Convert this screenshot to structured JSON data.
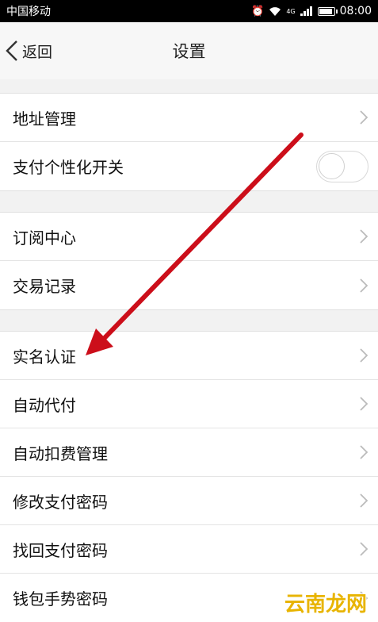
{
  "status_bar": {
    "carrier": "中国移动",
    "network": "4G",
    "time": "08:00"
  },
  "nav": {
    "back_label": "返回",
    "title": "设置"
  },
  "groups": [
    {
      "items": [
        {
          "label": "地址管理",
          "type": "link"
        },
        {
          "label": "支付个性化开关",
          "type": "toggle",
          "on": false
        }
      ]
    },
    {
      "items": [
        {
          "label": "订阅中心",
          "type": "link"
        },
        {
          "label": "交易记录",
          "type": "link"
        }
      ]
    },
    {
      "items": [
        {
          "label": "实名认证",
          "type": "link"
        },
        {
          "label": "自动代付",
          "type": "link"
        },
        {
          "label": "自动扣费管理",
          "type": "link"
        },
        {
          "label": "修改支付密码",
          "type": "link"
        },
        {
          "label": "找回支付密码",
          "type": "link"
        },
        {
          "label": "钱包手势密码",
          "type": "link"
        }
      ]
    }
  ],
  "annotation": {
    "color": "#cc0e1a"
  },
  "watermark": {
    "text": "云南龙网"
  }
}
